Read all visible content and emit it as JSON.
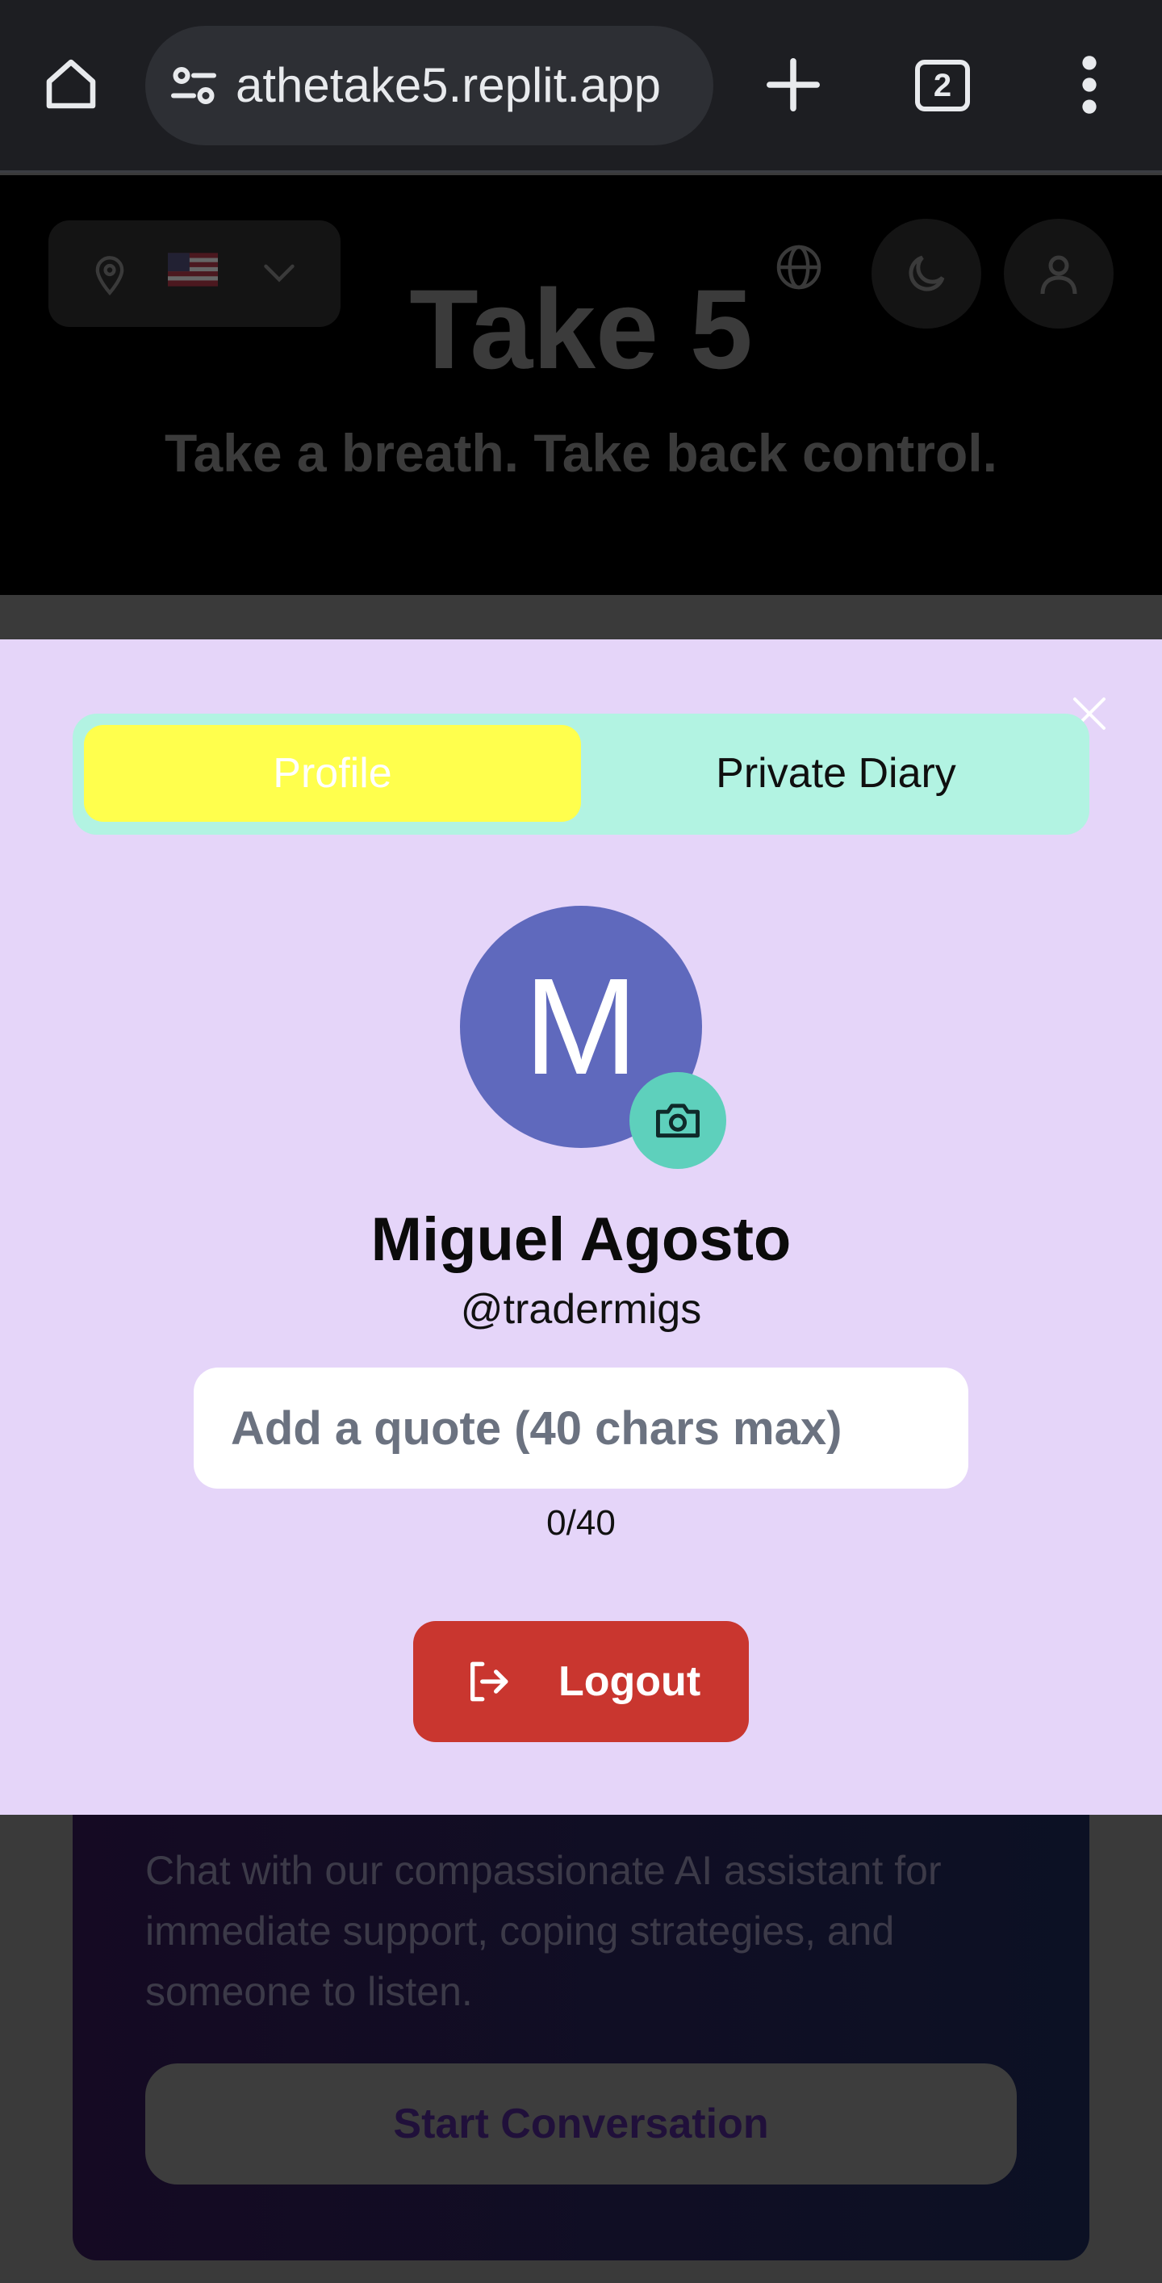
{
  "browser": {
    "url": "athetake5.replit.app",
    "tab_count": "2"
  },
  "page": {
    "title": "Take 5",
    "tagline": "Take a breath. Take back control.",
    "card": {
      "description": "Chat with our compassionate AI assistant for immediate support, coping strategies, and someone to listen.",
      "cta_label": "Start Conversation"
    }
  },
  "modal": {
    "tabs": [
      {
        "label": "Profile",
        "active": true
      },
      {
        "label": "Private Diary",
        "active": false
      }
    ],
    "avatar_initial": "M",
    "name": "Miguel Agosto",
    "handle": "@tradermigs",
    "quote_placeholder": "Add a quote (40 chars max)",
    "quote_value": "",
    "counter": "0/40",
    "logout_label": "Logout"
  },
  "colors": {
    "modal_bg": "#e5d5f9",
    "tab_active": "#ffff4d",
    "tab_bar": "#b2f3e2",
    "avatar_bg": "#5f69bd",
    "camera_bg": "#5ed0bc",
    "logout_bg": "#c9362f"
  }
}
